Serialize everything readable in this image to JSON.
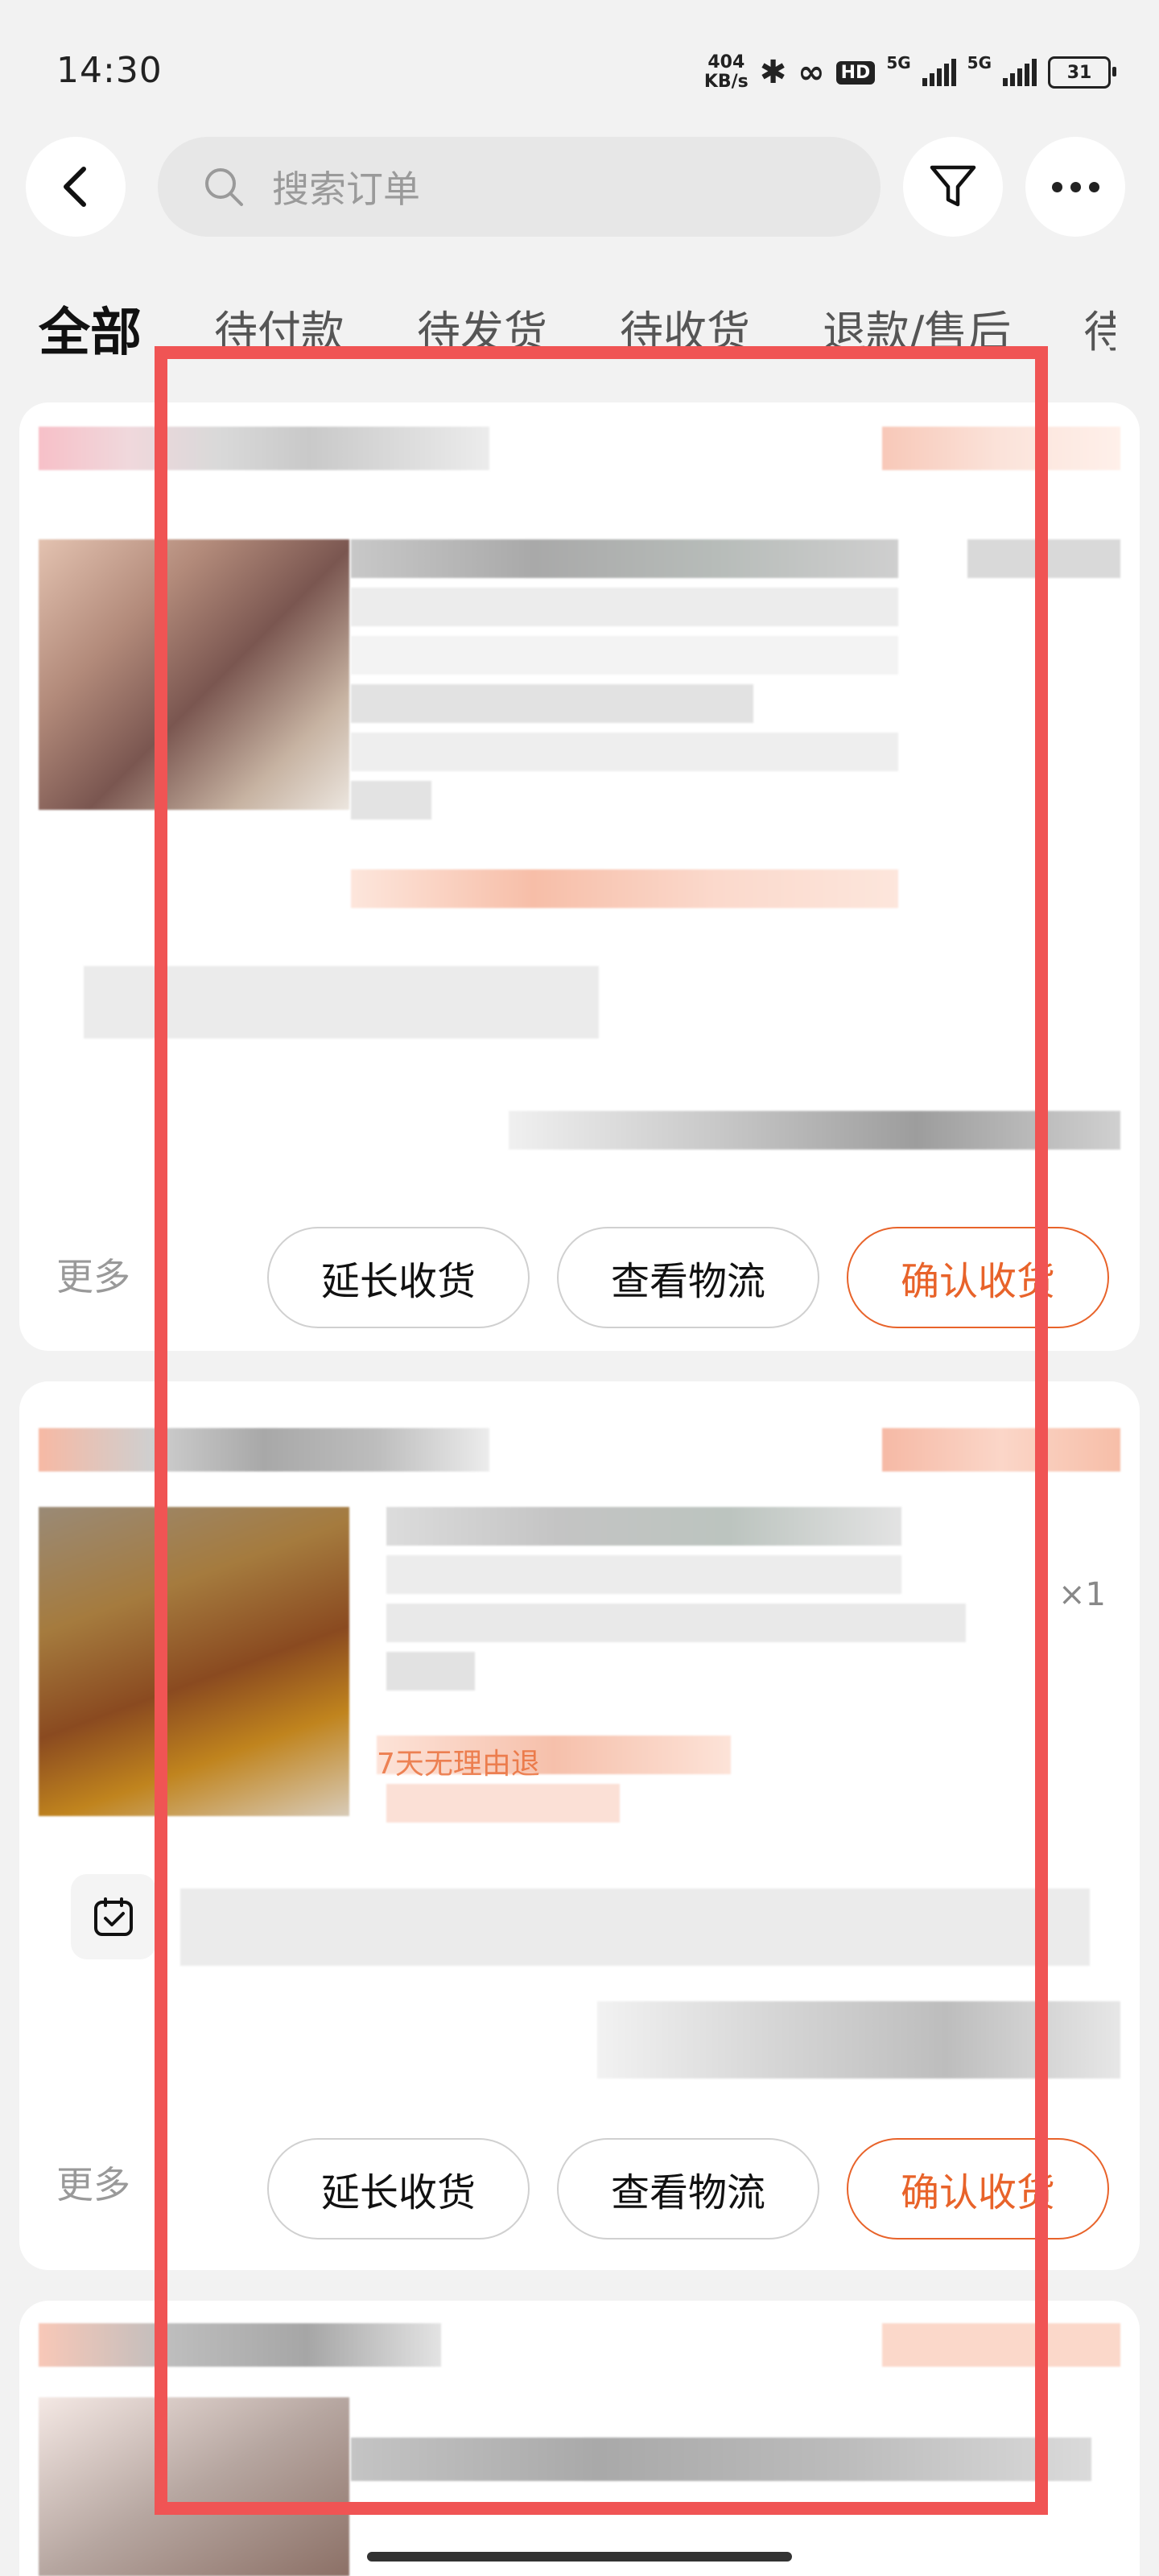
{
  "status_bar": {
    "time": "14:30",
    "net_speed_value": "404",
    "net_speed_unit": "KB/s",
    "hd_label": "HD",
    "sim1_label": "5G",
    "sim2_label": "5G",
    "battery": "31"
  },
  "header": {
    "search_placeholder": "搜索订单"
  },
  "tabs": [
    {
      "label": "全部",
      "active": true
    },
    {
      "label": "待付款"
    },
    {
      "label": "待发货"
    },
    {
      "label": "待收货"
    },
    {
      "label": "退款/售后"
    },
    {
      "label": "待"
    }
  ],
  "orders": [
    {
      "more_label": "更多",
      "actions": {
        "extend": "延长收货",
        "logistics": "查看物流",
        "confirm": "确认收货"
      }
    },
    {
      "qty": "×1",
      "promo": "7天无理由退",
      "more_label": "更多",
      "actions": {
        "extend": "延长收货",
        "logistics": "查看物流",
        "confirm": "确认收货"
      }
    }
  ],
  "colors": {
    "accent": "#e8632a",
    "overlay_border": "#f05454",
    "background": "#f2f2f2"
  }
}
